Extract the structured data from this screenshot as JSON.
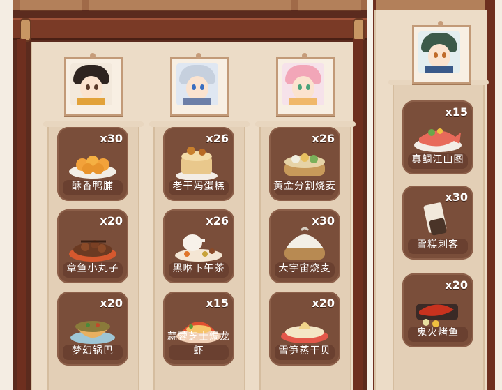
{
  "colors": {
    "frame": "#5b2b1e",
    "board": "#ecdcc7",
    "card": "#7a4e3a",
    "label_text": "#ffffff"
  },
  "left_panel": {
    "columns": [
      {
        "portrait": {
          "icon": "catgirl-character-portrait-icon"
        },
        "items": [
          {
            "qty": "x30",
            "name": "酥香鸭脯",
            "icon": "dumplings-plate-icon"
          },
          {
            "qty": "x20",
            "name": "章鱼小丸子",
            "icon": "takoyaki-plate-icon"
          },
          {
            "qty": "x20",
            "name": "梦幻锅巴",
            "icon": "crispy-rice-bowl-icon"
          }
        ]
      },
      {
        "portrait": {
          "icon": "silver-hair-character-portrait-icon"
        },
        "items": [
          {
            "qty": "x26",
            "name": "老干妈蛋糕",
            "icon": "cake-icon"
          },
          {
            "qty": "x26",
            "name": "黑咻下午茶",
            "icon": "afternoon-tea-icon"
          },
          {
            "qty": "x15",
            "name": "蒜蓉芝士焗龙虾",
            "icon": "lobster-dish-icon"
          }
        ]
      },
      {
        "portrait": {
          "icon": "pink-hair-character-portrait-icon"
        },
        "items": [
          {
            "qty": "x26",
            "name": "黄金分割烧麦",
            "icon": "shaomai-steamer-icon"
          },
          {
            "qty": "x30",
            "name": "大宇宙烧麦",
            "icon": "giant-bun-steamer-icon"
          },
          {
            "qty": "x20",
            "name": "雪笋蒸干贝",
            "icon": "scallop-dish-icon"
          }
        ]
      }
    ]
  },
  "right_panel": {
    "column": {
      "portrait": {
        "icon": "green-hair-character-portrait-icon"
      },
      "items": [
        {
          "qty": "x15",
          "name": "真鲷江山图",
          "icon": "sea-bream-platter-icon"
        },
        {
          "qty": "x30",
          "name": "雪糕刺客",
          "icon": "ice-cream-icon"
        },
        {
          "qty": "x20",
          "name": "鬼火烤鱼",
          "icon": "grilled-fish-icon"
        }
      ]
    }
  }
}
